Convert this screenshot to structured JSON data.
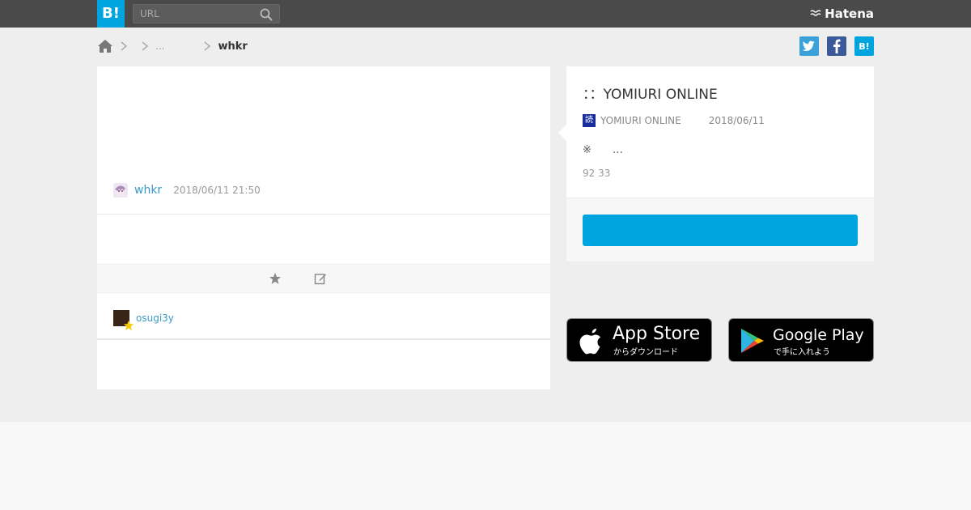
{
  "header": {
    "logo_text": "B!",
    "search_placeholder": "URL",
    "brand": "Hatena"
  },
  "breadcrumb": {
    "middle": "...",
    "current": "whkr"
  },
  "bookmark": {
    "username": "whkr",
    "timestamp": "2018/06/11 21:50"
  },
  "stars": {
    "user": "osugi3y"
  },
  "entry": {
    "title": "：：YOMIURI ONLINE",
    "favicon_char": "読",
    "source": "YOMIURI ONLINE",
    "date": "2018/06/11",
    "excerpt": "※　　…",
    "counts": "92 33"
  },
  "share": {
    "hatena_label": "B!"
  },
  "app_badges": {
    "apple_title": "App Store",
    "apple_sub": "からダウンロード",
    "google_title": "Google Play",
    "google_sub": "で手に入れよう"
  },
  "colors": {
    "brand_blue": "#00a4de",
    "twitter": "#3aa1d9",
    "facebook": "#3b5999",
    "link": "#3a9bc7"
  }
}
